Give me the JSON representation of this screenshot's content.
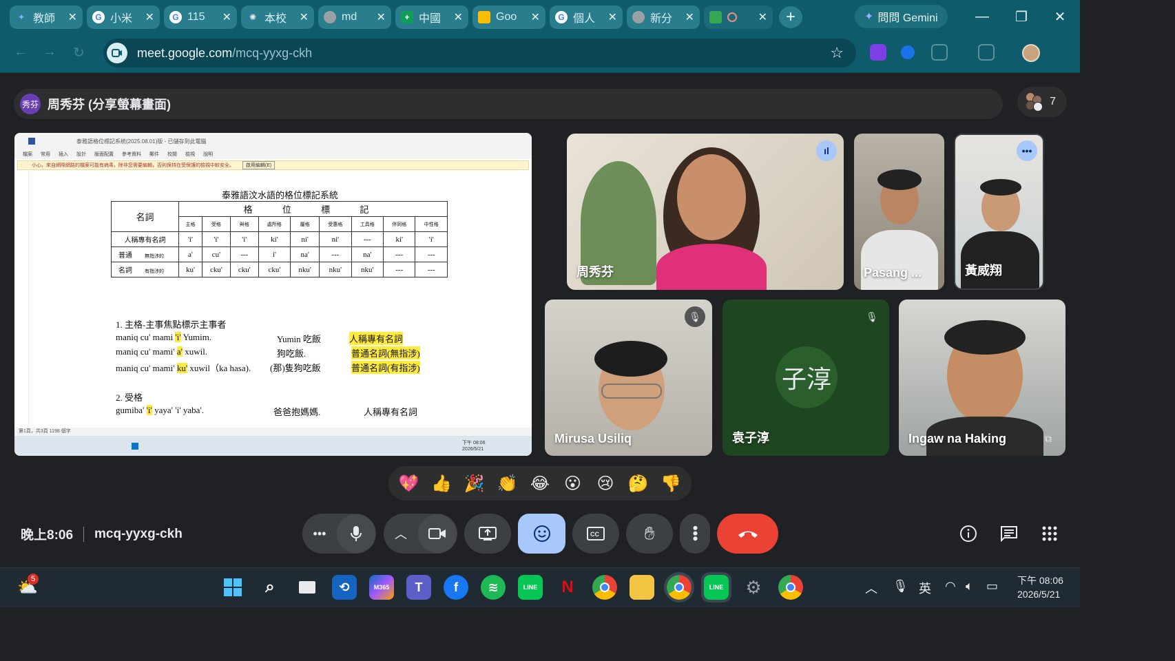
{
  "browser": {
    "tabs": [
      {
        "label": "教師",
        "favicon": "gemini-icon"
      },
      {
        "label": "小米",
        "favicon": "google-icon"
      },
      {
        "label": "115",
        "favicon": "google-icon"
      },
      {
        "label": "本校",
        "favicon": "gear-icon"
      },
      {
        "label": "md",
        "favicon": "globe-icon"
      },
      {
        "label": "中國",
        "favicon": "plus-icon"
      },
      {
        "label": "Goo",
        "favicon": "drive-icon"
      },
      {
        "label": "個人",
        "favicon": "google-icon"
      },
      {
        "label": "新分",
        "favicon": "chrome-icon"
      },
      {
        "label": "",
        "favicon": "meet-icon"
      }
    ],
    "gemini_button": "問問 Gemini",
    "url_host": "meet.google.com",
    "url_path": "/mcq-yyxg-ckh"
  },
  "meeting": {
    "presenter_initials": "秀芬",
    "presenter_title": "周秀芬 (分享螢幕畫面)",
    "participant_count": "7",
    "time": "晚上8:06",
    "code": "mcq-yyxg-ckh"
  },
  "shared_doc": {
    "window_title": "泰雅語格位標記系統(2025.08.01)版 - 已儲存到此電腦",
    "ribbon_tabs": [
      "檔案",
      "常用",
      "插入",
      "設計",
      "版面配置",
      "參考資料",
      "郵件",
      "校閱",
      "檢視",
      "說明"
    ],
    "warning": "小心，來自網際網路的檔案可能有病毒，除非您需要編輯，否則保持在受保護的檢視中較安全。",
    "warning_button": "啟用編輯(E)",
    "title": "泰雅語汶水語的格位標記系統",
    "table": {
      "noun_header": "名詞",
      "group_header": "格 位 標 記",
      "cases": [
        "主格",
        "受格",
        "與格",
        "處所格",
        "屬格",
        "受惠格",
        "工具格",
        "伴同格",
        "中性格"
      ],
      "rows": [
        {
          "label": "人稱專有名詞",
          "sub": "",
          "cells": [
            "'i'",
            "'i'",
            "'i'",
            "ki'",
            "ni'",
            "ni'",
            "---",
            "ki'",
            "'i'"
          ]
        },
        {
          "label": "普通",
          "sub": "無指涉的",
          "cells": [
            "a'",
            "cu'",
            "---",
            "i'",
            "na'",
            "---",
            "na'",
            "---",
            "---"
          ]
        },
        {
          "label": "名詞",
          "sub": "有指涉的",
          "cells": [
            "ku'",
            "cku'",
            "cku'",
            "cku'",
            "nku'",
            "nku'",
            "nku'",
            "---",
            "---"
          ]
        }
      ]
    },
    "sec1": "1. 主格-主事焦點標示主事者",
    "lines": [
      {
        "a": "maniq cu' mami ",
        "h": "'i'",
        "b": " Yumim.",
        "zh": "Yumin 吃飯",
        "tag": "人稱專有名詞"
      },
      {
        "a": "maniq cu' mami' ",
        "h": "a'",
        "b": " xuwil.",
        "zh": "狗吃飯.",
        "tag": "普通名詞(無指涉)"
      },
      {
        "a": "maniq cu' mami' ",
        "h": "ku'",
        "b": " xuwil（ka hasa).",
        "zh": "(那)隻狗吃飯",
        "tag": "普通名詞(有指涉)"
      }
    ],
    "sec2": "2. 受格",
    "line4": {
      "a": "gumiba' ",
      "h": "'i'",
      "b": " yaya' 'i' yaba'.",
      "zh": "爸爸抱媽媽.",
      "tag": "人稱專有名詞"
    },
    "status": "第1頁，共3頁   1198 個字",
    "inner_clock": "下午 08:06 2026/5/21"
  },
  "participants": [
    {
      "name": "周秀芬",
      "speaking": true
    },
    {
      "name": "Pasang ...",
      "speaking": false
    },
    {
      "name": "黃威翔",
      "speaking": false
    },
    {
      "name": "Mirusa Usiliq",
      "muted": true
    },
    {
      "name": "袁子淳",
      "initials": "子淳",
      "muted": true
    },
    {
      "name": "Ingaw na Haking",
      "speaking": false
    }
  ],
  "reactions": [
    "💖",
    "👍",
    "🎉",
    "👏",
    "😂",
    "😮",
    "😢",
    "🤔",
    "👎"
  ],
  "taskbar": {
    "notification_count": "5",
    "ime": "英",
    "time": "下午 08:06",
    "date": "2026/5/21",
    "m365": "M365"
  },
  "colors": {
    "accent_blue": "#a8c7fa",
    "end_call_red": "#ea4335",
    "browser_teal": "#0d5b6b"
  }
}
